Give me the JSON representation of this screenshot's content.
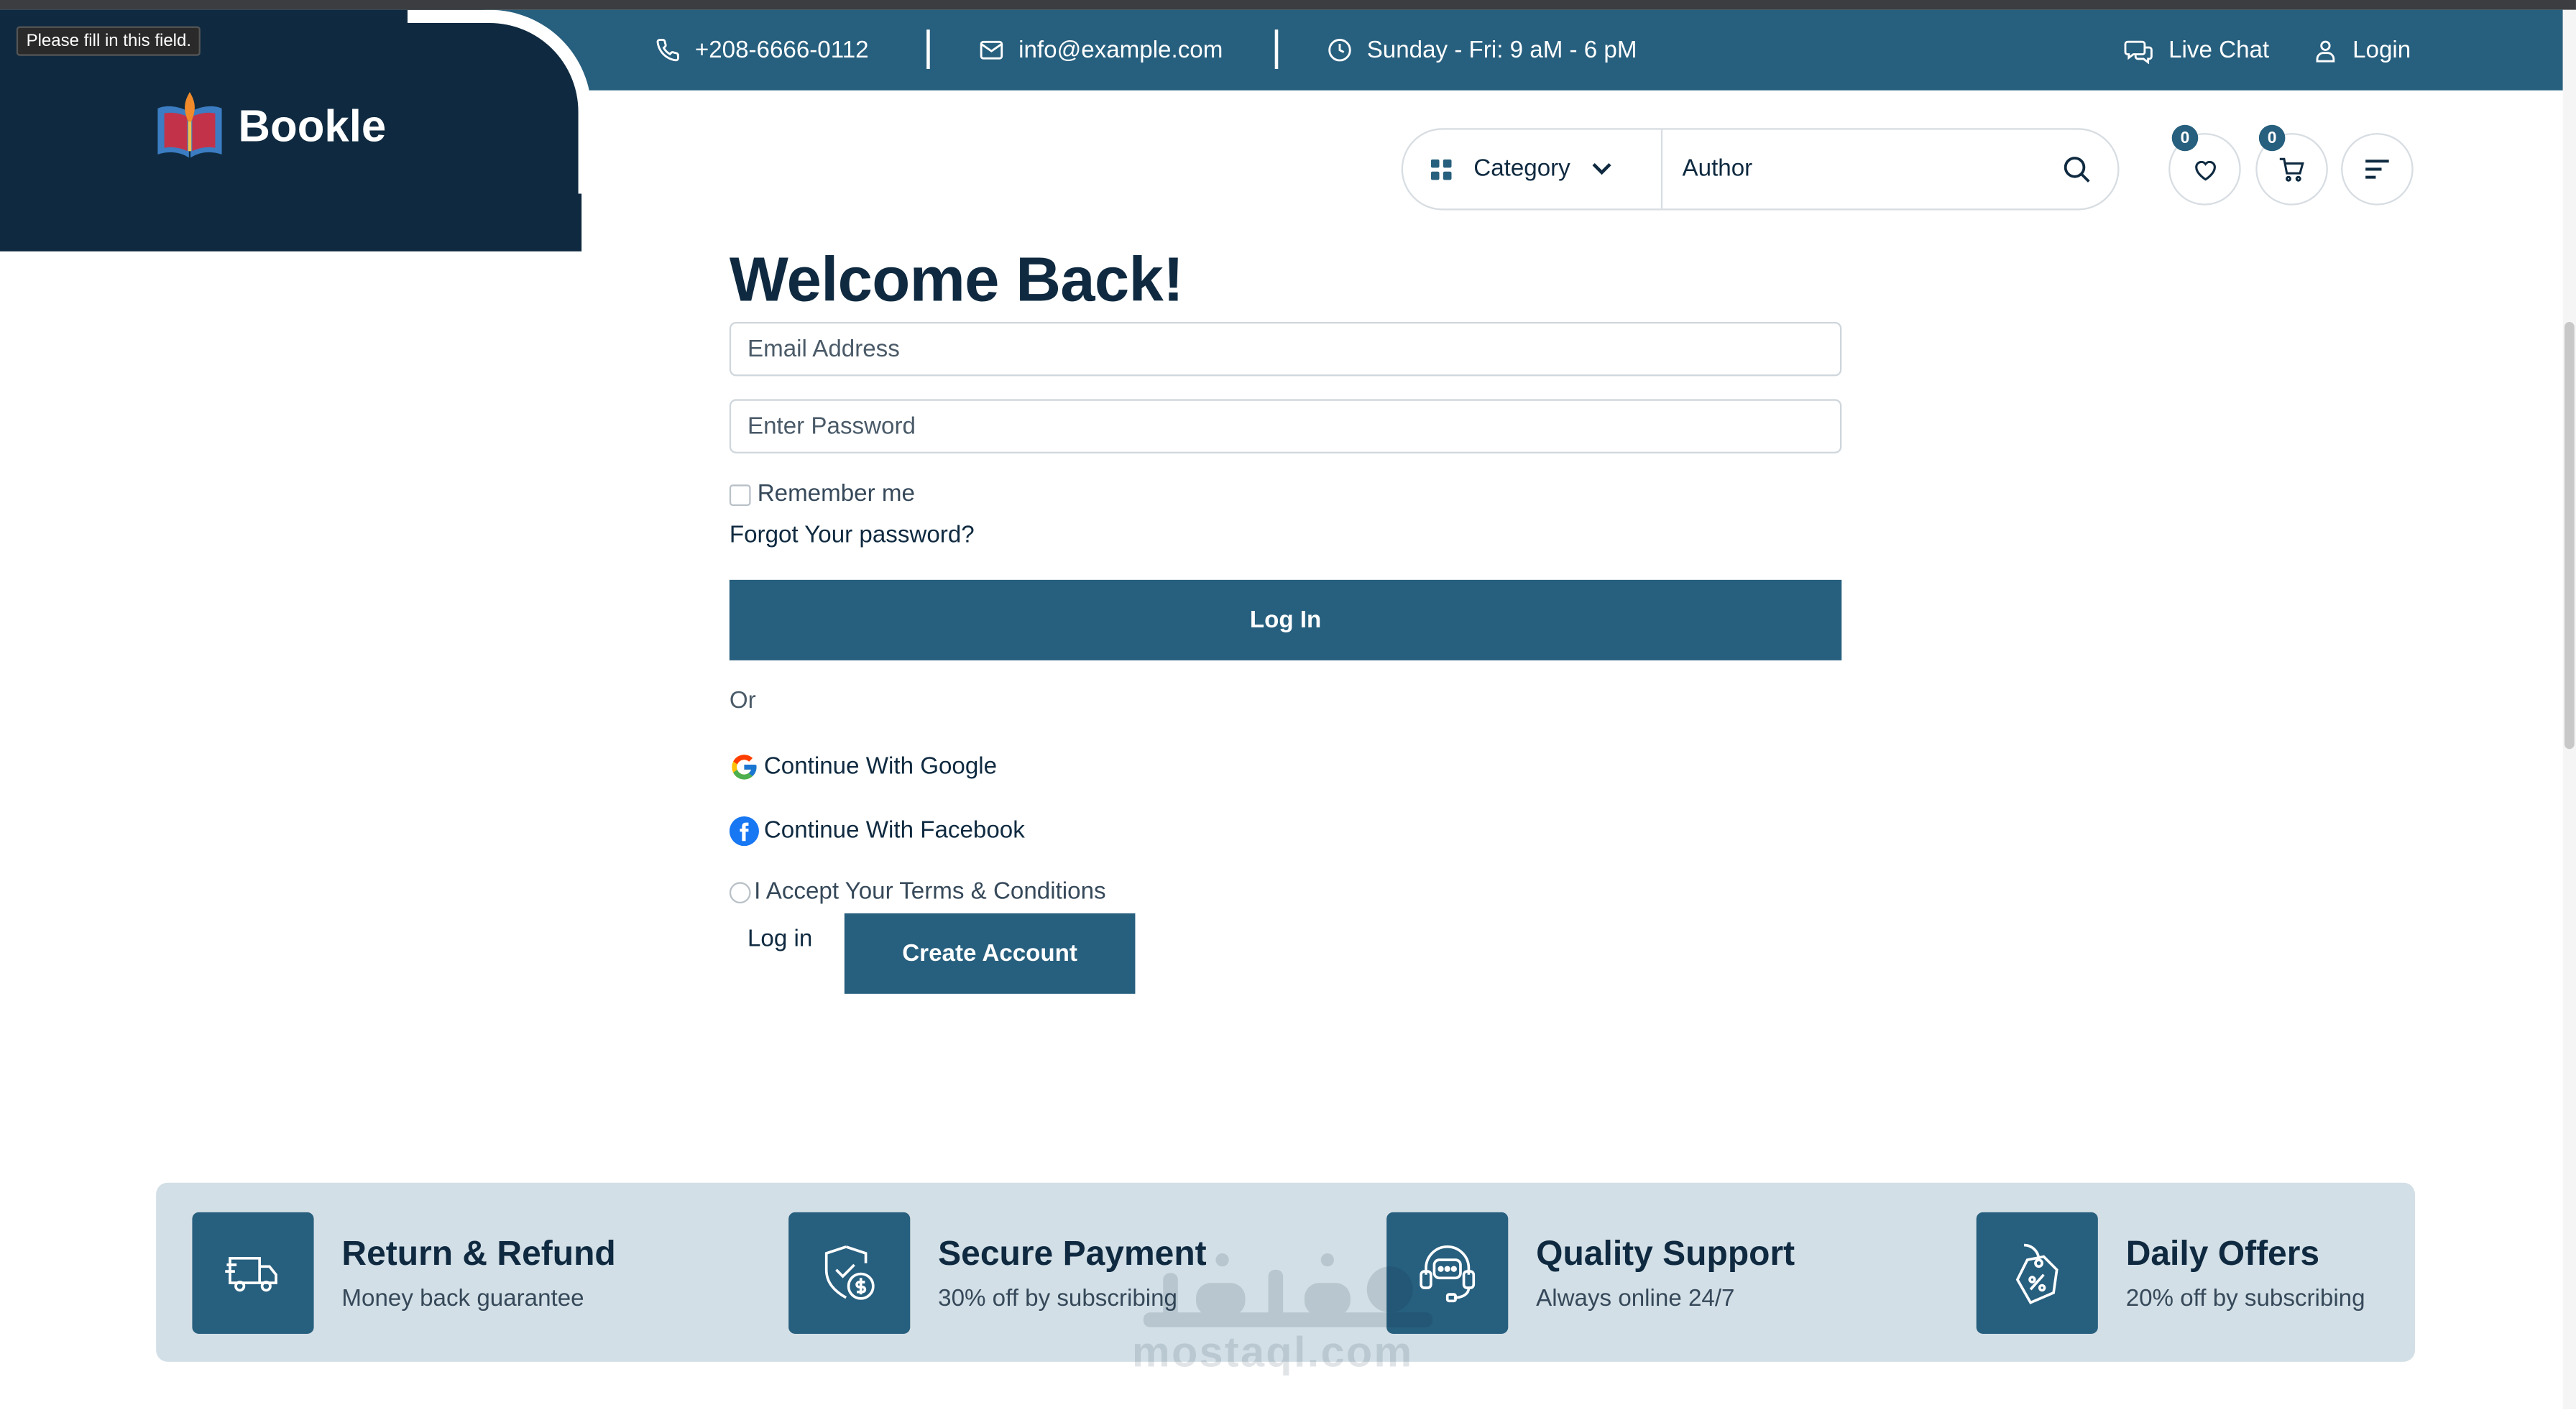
{
  "tooltip": "Please fill in this field.",
  "brand": {
    "name": "Bookle"
  },
  "topbar": {
    "phone": "+208-6666-0112",
    "email": "info@example.com",
    "hours": "Sunday - Fri: 9 aM - 6 pM",
    "live_chat": "Live Chat",
    "login": "Login"
  },
  "search": {
    "category_label": "Category",
    "placeholder": "Author"
  },
  "header_actions": {
    "wishlist_count": "0",
    "cart_count": "0"
  },
  "login_form": {
    "title": "Welcome Back!",
    "email_placeholder": "Email Address",
    "password_placeholder": "Enter Password",
    "remember_label": "Remember me",
    "forgot_label": "Forgot Your password?",
    "login_button": "Log In",
    "or_label": "Or",
    "google_label": "Continue With Google",
    "facebook_label": "Continue With Facebook",
    "terms_label": "I Accept Your Terms & Conditions",
    "login_link": "Log in",
    "create_button": "Create Account"
  },
  "features": [
    {
      "icon": "delivery-truck-icon",
      "title": "Return & Refund",
      "subtitle": "Money back guarantee"
    },
    {
      "icon": "shield-dollar-icon",
      "title": "Secure Payment",
      "subtitle": "30% off by subscribing"
    },
    {
      "icon": "headset-support-icon",
      "title": "Quality Support",
      "subtitle": "Always online 24/7"
    },
    {
      "icon": "discount-tag-icon",
      "title": "Daily Offers",
      "subtitle": "20% off by subscribing"
    }
  ],
  "watermark": {
    "text": "mostaql.com"
  },
  "colors": {
    "primary": "#275f7e",
    "dark": "#0f2a40",
    "feature_bg": "#d3dfe6"
  }
}
